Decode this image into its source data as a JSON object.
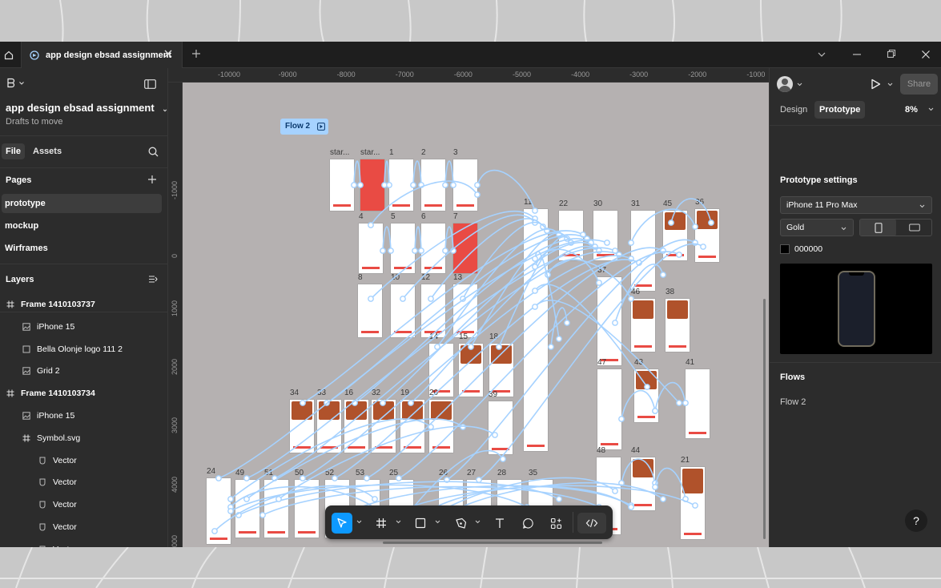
{
  "tab": {
    "title": "app design ebsad assignment"
  },
  "file": {
    "title": "app design ebsad assignment",
    "subtitle": "Drafts to move"
  },
  "left_tabs": {
    "file": "File",
    "assets": "Assets"
  },
  "pages": {
    "heading": "Pages",
    "items": [
      "prototype",
      "mockup",
      "Wirframes"
    ]
  },
  "layers": {
    "heading": "Layers",
    "items": [
      {
        "name": "Frame 1410103737",
        "kind": "frame",
        "indent": 0
      },
      {
        "name": "iPhone 15",
        "kind": "image",
        "indent": 1
      },
      {
        "name": "Bella Olonje logo 111 2",
        "kind": "rect",
        "indent": 1
      },
      {
        "name": "Grid 2",
        "kind": "image",
        "indent": 1
      },
      {
        "name": "Frame 1410103734",
        "kind": "frame",
        "indent": 0
      },
      {
        "name": "iPhone 15",
        "kind": "image",
        "indent": 1
      },
      {
        "name": "Symbol.svg",
        "kind": "frame",
        "indent": 1
      },
      {
        "name": "Vector",
        "kind": "vector",
        "indent": 2
      },
      {
        "name": "Vector",
        "kind": "vector",
        "indent": 2
      },
      {
        "name": "Vector",
        "kind": "vector",
        "indent": 2
      },
      {
        "name": "Vector",
        "kind": "vector",
        "indent": 2
      },
      {
        "name": "Vector",
        "kind": "vector",
        "indent": 2
      }
    ]
  },
  "ruler": {
    "top": [
      "-10000",
      "-9000",
      "-8000",
      "-7000",
      "-6000",
      "-5000",
      "-4000",
      "-3000",
      "-2000",
      "-1000"
    ],
    "left": [
      "-1000",
      "0",
      "1000",
      "2000",
      "3000",
      "4000",
      "5000"
    ]
  },
  "canvas": {
    "flow_tag": "Flow 2",
    "frame_labels": [
      "star...",
      "star...",
      "1",
      "2",
      "3",
      "4",
      "5",
      "6",
      "7",
      "8",
      "10",
      "12",
      "13",
      "11",
      "22",
      "30",
      "31",
      "45",
      "36",
      "37",
      "46",
      "38",
      "14",
      "15",
      "18",
      "34",
      "33",
      "16",
      "32",
      "19",
      "20",
      "39",
      "47",
      "43",
      "41",
      "48",
      "44",
      "21",
      "24",
      "49",
      "51",
      "50",
      "52",
      "53",
      "25",
      "26",
      "27",
      "28",
      "35"
    ]
  },
  "right": {
    "share": "Share",
    "design_tab": "Design",
    "prototype_tab": "Prototype",
    "zoom": "8%",
    "settings_heading": "Prototype settings",
    "device": "iPhone 11 Pro Max",
    "color_model": "Gold",
    "background": "000000",
    "flows_heading": "Flows",
    "flow_item": "Flow 2"
  },
  "colors": {
    "accent": "#0d99ff",
    "flow": "#a6d2ff",
    "brand_red": "#e94b44",
    "canvas": "#b5b1b1"
  },
  "help": "?"
}
